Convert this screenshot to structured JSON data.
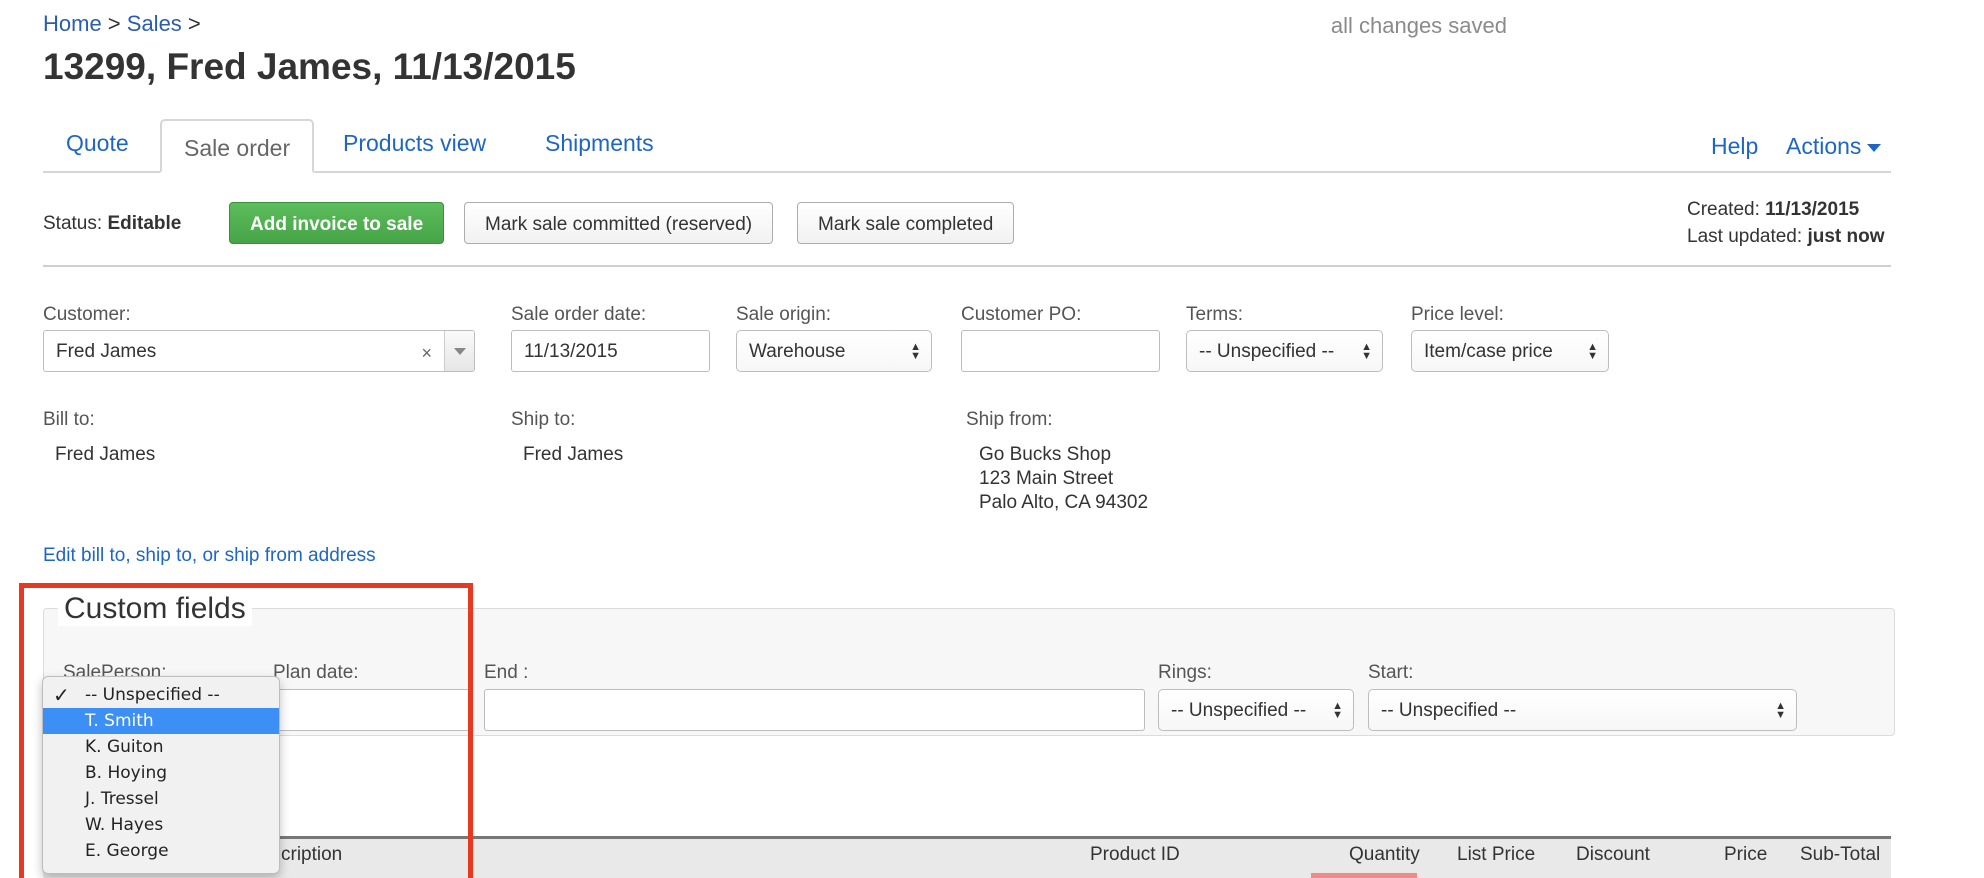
{
  "breadcrumb": {
    "home": "Home",
    "sep1": " > ",
    "sales": "Sales",
    "sep2": " >"
  },
  "save_status": "all changes saved",
  "title": "13299, Fred James, 11/13/2015",
  "tabs": [
    {
      "label": "Quote"
    },
    {
      "label": "Sale order"
    },
    {
      "label": "Products view"
    },
    {
      "label": "Shipments"
    }
  ],
  "header_links": {
    "help": "Help",
    "actions": "Actions"
  },
  "status": {
    "label": "Status:",
    "value": "Editable"
  },
  "buttons": {
    "add_invoice": "Add invoice to sale",
    "mark_committed": "Mark sale committed (reserved)",
    "mark_completed": "Mark sale completed"
  },
  "meta": {
    "created_label": "Created:",
    "created_value": "11/13/2015",
    "updated_label": "Last updated:",
    "updated_value": "just now"
  },
  "form": {
    "customer": {
      "label": "Customer:",
      "value": "Fred James"
    },
    "sale_order_date": {
      "label": "Sale order date:",
      "value": "11/13/2015"
    },
    "sale_origin": {
      "label": "Sale origin:",
      "value": "Warehouse"
    },
    "customer_po": {
      "label": "Customer PO:",
      "value": ""
    },
    "terms": {
      "label": "Terms:",
      "value": "-- Unspecified --"
    },
    "price_level": {
      "label": "Price level:",
      "value": "Item/case price"
    }
  },
  "addresses": {
    "bill_to": {
      "label": "Bill to:",
      "lines": [
        "Fred James"
      ]
    },
    "ship_to": {
      "label": "Ship to:",
      "lines": [
        "Fred James"
      ]
    },
    "ship_from": {
      "label": "Ship from:",
      "lines": [
        "Go Bucks Shop",
        "123 Main Street",
        "Palo Alto, CA 94302"
      ]
    }
  },
  "edit_address_link": "Edit bill to, ship to, or ship from address",
  "custom_fields": {
    "title": "Custom fields",
    "sale_person": {
      "label": "SalePerson:"
    },
    "plan_date": {
      "label": "Plan date:",
      "value": ""
    },
    "end": {
      "label": "End :",
      "value": ""
    },
    "rings": {
      "label": "Rings:",
      "value": "-- Unspecified --"
    },
    "start": {
      "label": "Start:",
      "value": "-- Unspecified --"
    }
  },
  "dropdown": {
    "checkmark": "✓",
    "options": [
      "-- Unspecified --",
      "T. Smith",
      "K. Guiton",
      "B. Hoying",
      "J. Tressel",
      "W. Hayes",
      "E. George"
    ],
    "checked_index": 0,
    "highlighted_index": 1
  },
  "table_header": {
    "description": "Description",
    "description_visible": "cription",
    "product_id": "Product ID",
    "quantity": "Quantity",
    "list_price": "List Price",
    "discount": "Discount",
    "price": "Price",
    "subtotal": "Sub-Total"
  },
  "colors": {
    "link": "#1f66c4",
    "success_button": "#46a446",
    "highlight_border": "#e8381f",
    "selected_option": "#3b8ff5"
  }
}
